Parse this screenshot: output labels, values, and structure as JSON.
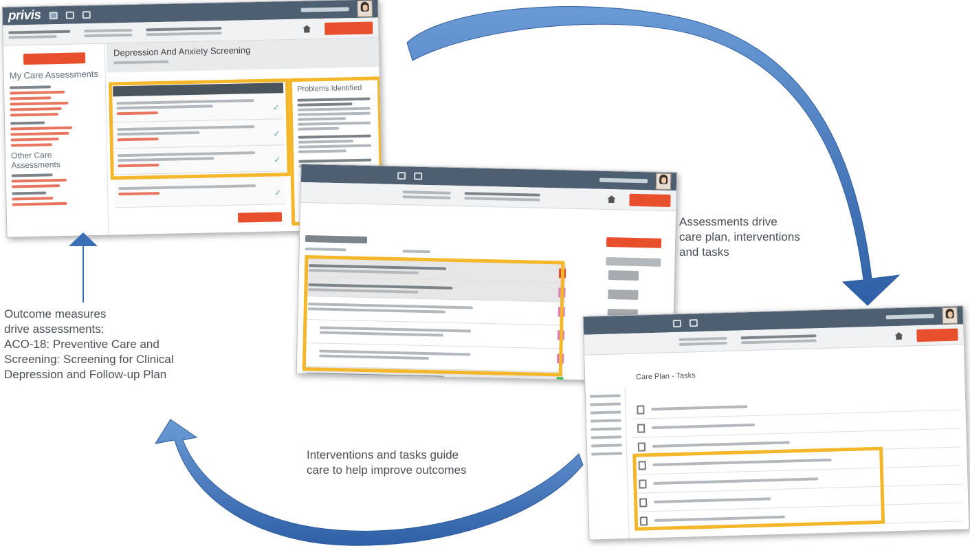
{
  "screenshot_1": {
    "logo": "privis",
    "page_heading": "Depression And Anxiety Screening",
    "left_section_1": "My Care Assessments",
    "left_section_2": "Other Care Assessments",
    "side_panel_title": "Problems Identified"
  },
  "screenshot_2": {},
  "screenshot_3": {
    "header_fragment": "Care Plan - Tasks"
  },
  "captions": {
    "outcome_measures": [
      "Outcome measures",
      "drive assessments:",
      "ACO-18: Preventive Care and",
      "Screening: Screening for Clinical",
      "Depression and Follow-up Plan"
    ],
    "assessments_drive": [
      "Assessments drive",
      "care plan, interventions",
      "and tasks"
    ],
    "interventions_guide": [
      "Interventions and tasks guide",
      "care to help improve outcomes"
    ]
  },
  "colors": {
    "arrow": "#3a6fb5",
    "highlight": "#f4b72a",
    "topbar": "#4d5f70",
    "accent_red": "#e8502d"
  },
  "icons": [
    "home-icon",
    "user-avatar",
    "nav-icon",
    "check-icon",
    "document-icon"
  ]
}
